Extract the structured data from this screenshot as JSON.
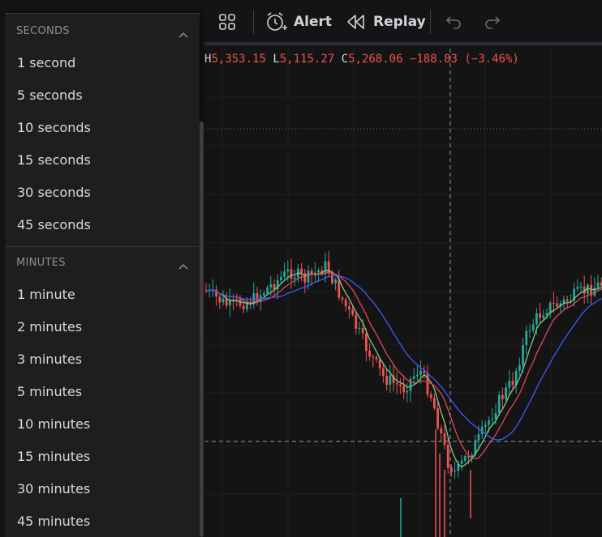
{
  "toolbar": {
    "alert_label": "Alert",
    "replay_label": "Replay",
    "icons": [
      "layout-grid-icon",
      "alarm-clock-icon",
      "replay-rewind-icon",
      "undo-icon",
      "redo-icon"
    ]
  },
  "ohlc": {
    "h_label": "H",
    "h_value": "5,353.15",
    "l_label": "L",
    "l_value": "5,115.27",
    "c_label": "C",
    "c_value": "5,268.06",
    "change": "−188.83 (−3.46%)"
  },
  "menu": {
    "seconds_header": "SECONDS",
    "seconds": [
      "1 second",
      "5 seconds",
      "10 seconds",
      "15 seconds",
      "30 seconds",
      "45 seconds"
    ],
    "minutes_header": "MINUTES",
    "minutes": [
      "1 minute",
      "2 minutes",
      "3 minutes",
      "5 minutes",
      "10 minutes",
      "15 minutes",
      "30 minutes",
      "45 minutes"
    ]
  },
  "colors": {
    "background": "#141414",
    "menu_bg": "#1e1e1e",
    "up_candle": "#26a69a",
    "down_candle": "#ef5350",
    "ma_fast": "#81c784",
    "ma_mid": "#e0475b",
    "ma_slow": "#3d5afe"
  }
}
